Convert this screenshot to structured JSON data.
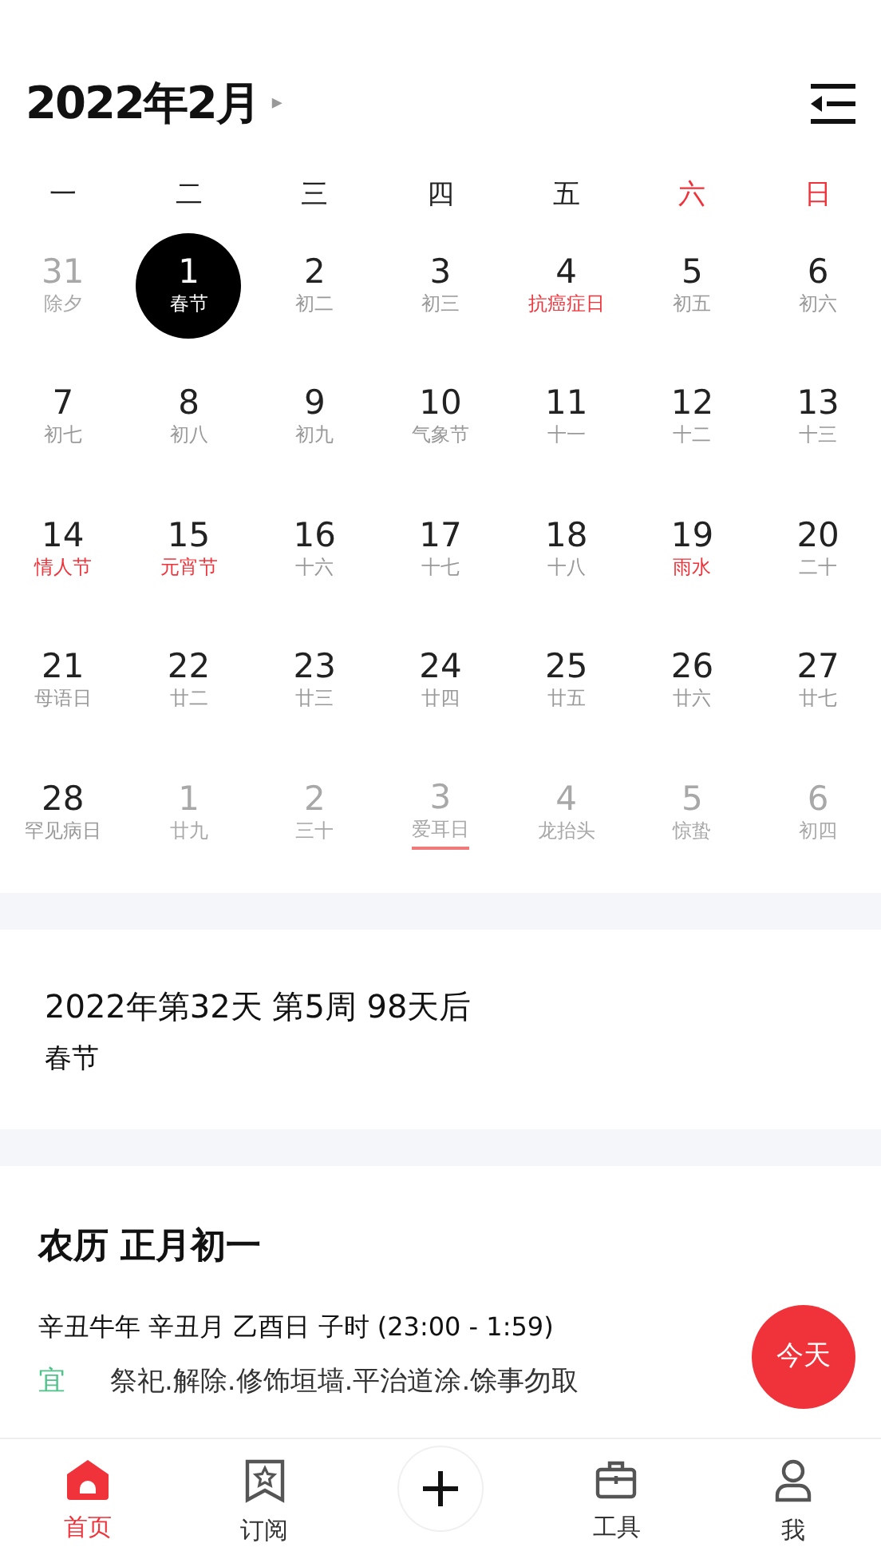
{
  "header": {
    "title": "2022年2月",
    "caret": "▸"
  },
  "weekdays": [
    {
      "label": "一",
      "weekend": false
    },
    {
      "label": "二",
      "weekend": false
    },
    {
      "label": "三",
      "weekend": false
    },
    {
      "label": "四",
      "weekend": false
    },
    {
      "label": "五",
      "weekend": false
    },
    {
      "label": "六",
      "weekend": true
    },
    {
      "label": "日",
      "weekend": true
    }
  ],
  "days": [
    {
      "day": "31",
      "lunar": "除夕",
      "kind": "other",
      "festival": false,
      "selected": false
    },
    {
      "day": "1",
      "lunar": "春节",
      "kind": "current",
      "festival": false,
      "selected": true
    },
    {
      "day": "2",
      "lunar": "初二",
      "kind": "current",
      "festival": false,
      "selected": false
    },
    {
      "day": "3",
      "lunar": "初三",
      "kind": "current",
      "festival": false,
      "selected": false
    },
    {
      "day": "4",
      "lunar": "抗癌症日",
      "kind": "current",
      "festival": true,
      "selected": false
    },
    {
      "day": "5",
      "lunar": "初五",
      "kind": "current",
      "festival": false,
      "selected": false
    },
    {
      "day": "6",
      "lunar": "初六",
      "kind": "current",
      "festival": false,
      "selected": false
    },
    {
      "day": "7",
      "lunar": "初七",
      "kind": "current",
      "festival": false,
      "selected": false
    },
    {
      "day": "8",
      "lunar": "初八",
      "kind": "current",
      "festival": false,
      "selected": false
    },
    {
      "day": "9",
      "lunar": "初九",
      "kind": "current",
      "festival": false,
      "selected": false
    },
    {
      "day": "10",
      "lunar": "气象节",
      "kind": "current",
      "festival": false,
      "selected": false
    },
    {
      "day": "11",
      "lunar": "十一",
      "kind": "current",
      "festival": false,
      "selected": false
    },
    {
      "day": "12",
      "lunar": "十二",
      "kind": "current",
      "festival": false,
      "selected": false
    },
    {
      "day": "13",
      "lunar": "十三",
      "kind": "current",
      "festival": false,
      "selected": false
    },
    {
      "day": "14",
      "lunar": "情人节",
      "kind": "current",
      "festival": true,
      "selected": false
    },
    {
      "day": "15",
      "lunar": "元宵节",
      "kind": "current",
      "festival": true,
      "selected": false
    },
    {
      "day": "16",
      "lunar": "十六",
      "kind": "current",
      "festival": false,
      "selected": false
    },
    {
      "day": "17",
      "lunar": "十七",
      "kind": "current",
      "festival": false,
      "selected": false
    },
    {
      "day": "18",
      "lunar": "十八",
      "kind": "current",
      "festival": false,
      "selected": false
    },
    {
      "day": "19",
      "lunar": "雨水",
      "kind": "current",
      "festival": true,
      "selected": false
    },
    {
      "day": "20",
      "lunar": "二十",
      "kind": "current",
      "festival": false,
      "selected": false
    },
    {
      "day": "21",
      "lunar": "母语日",
      "kind": "current",
      "festival": false,
      "selected": false
    },
    {
      "day": "22",
      "lunar": "廿二",
      "kind": "current",
      "festival": false,
      "selected": false
    },
    {
      "day": "23",
      "lunar": "廿三",
      "kind": "current",
      "festival": false,
      "selected": false
    },
    {
      "day": "24",
      "lunar": "廿四",
      "kind": "current",
      "festival": false,
      "selected": false
    },
    {
      "day": "25",
      "lunar": "廿五",
      "kind": "current",
      "festival": false,
      "selected": false
    },
    {
      "day": "26",
      "lunar": "廿六",
      "kind": "current",
      "festival": false,
      "selected": false
    },
    {
      "day": "27",
      "lunar": "廿七",
      "kind": "current",
      "festival": false,
      "selected": false
    },
    {
      "day": "28",
      "lunar": "罕见病日",
      "kind": "current",
      "festival": false,
      "selected": false
    },
    {
      "day": "1",
      "lunar": "廿九",
      "kind": "other",
      "festival": false,
      "selected": false
    },
    {
      "day": "2",
      "lunar": "三十",
      "kind": "other",
      "festival": false,
      "selected": false
    },
    {
      "day": "3",
      "lunar": "爱耳日",
      "kind": "other",
      "festival": false,
      "selected": false,
      "underlined": true
    },
    {
      "day": "4",
      "lunar": "龙抬头",
      "kind": "other",
      "festival": false,
      "selected": false
    },
    {
      "day": "5",
      "lunar": "惊蛰",
      "kind": "other",
      "festival": false,
      "selected": false
    },
    {
      "day": "6",
      "lunar": "初四",
      "kind": "other",
      "festival": false,
      "selected": false
    }
  ],
  "info": {
    "summary": "2022年第32天 第5周 98天后",
    "festival": "春节"
  },
  "almanac": {
    "title": "农历 正月初一",
    "ganzhi": "辛丑牛年 辛丑月 乙酉日 子时 (23:00 - 1:59)",
    "rows": [
      {
        "label": "宜",
        "kind": "good",
        "text": "祭祀.解除.修饰垣墙.平治道涂.馀事勿取"
      }
    ]
  },
  "today_button": "今天",
  "nav": [
    {
      "kind": "home",
      "label": "首页",
      "selected": true
    },
    {
      "kind": "subscribe",
      "label": "订阅",
      "selected": false
    },
    {
      "kind": "add",
      "selected": false
    },
    {
      "kind": "tools",
      "label": "工具",
      "selected": false
    },
    {
      "kind": "me",
      "label": "我",
      "selected": false
    }
  ]
}
